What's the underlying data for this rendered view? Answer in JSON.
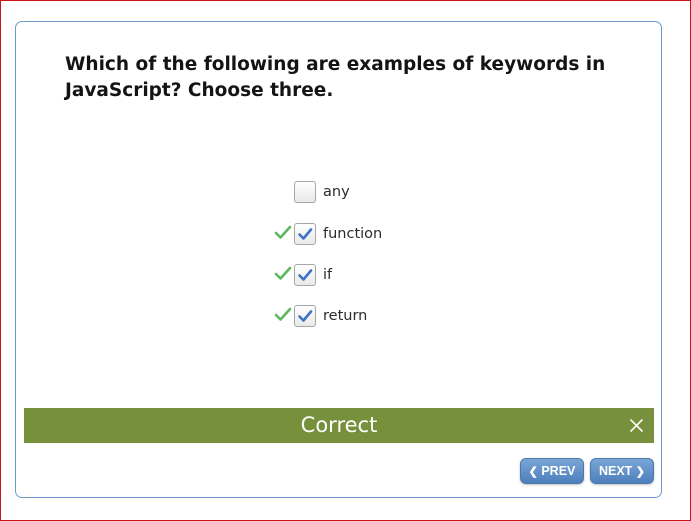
{
  "question": {
    "text": "Which of the following are examples of keywords in JavaScript? Choose three."
  },
  "options": [
    {
      "label": "any",
      "checked": false,
      "correct_mark": false
    },
    {
      "label": "function",
      "checked": true,
      "correct_mark": true
    },
    {
      "label": "if",
      "checked": true,
      "correct_mark": true
    },
    {
      "label": "return",
      "checked": true,
      "correct_mark": true
    }
  ],
  "feedback": {
    "text": "Correct",
    "color": "#77903c"
  },
  "navigation": {
    "prev_label": "PREV",
    "next_label": "NEXT",
    "prev_icon": "chevron-left-icon",
    "next_icon": "chevron-right-icon"
  },
  "colors": {
    "frame_border": "#c8141b",
    "card_border": "#6f9bc8",
    "tick_green": "#5cb85c",
    "check_blue": "#3f74c4",
    "button_blue": "#5a8cc8"
  }
}
